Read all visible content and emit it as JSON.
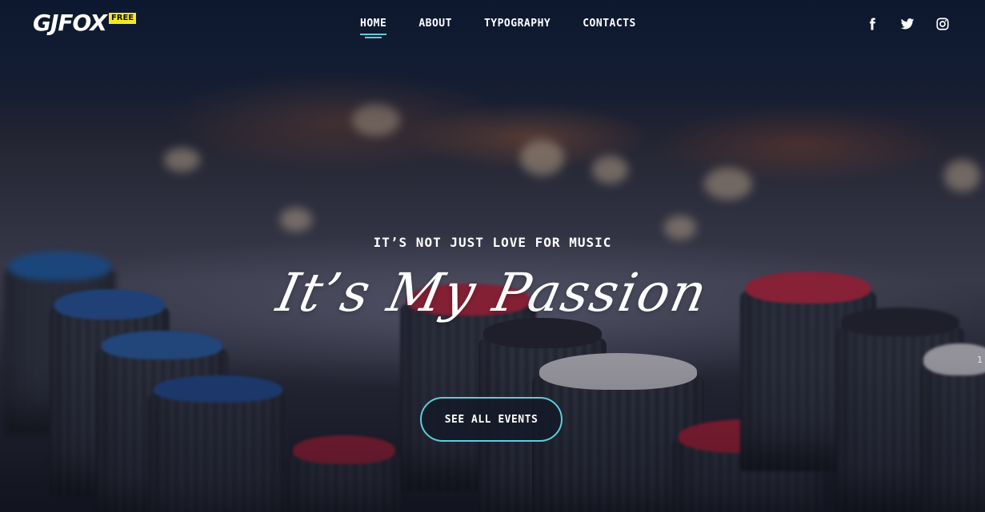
{
  "brand": {
    "logo_prefix": "GJ",
    "logo_name": "FOX",
    "badge": "FREE",
    "accent_color": "#5fcdd9",
    "badge_color": "#f5e629"
  },
  "nav": {
    "items": [
      {
        "label": "HOME",
        "active": true
      },
      {
        "label": "ABOUT",
        "active": false
      },
      {
        "label": "TYPOGRAPHY",
        "active": false
      },
      {
        "label": "CONTACTS",
        "active": false
      }
    ]
  },
  "social": {
    "icons": [
      "facebook-icon",
      "twitter-icon",
      "instagram-icon"
    ]
  },
  "hero": {
    "eyebrow": "IT’S NOT JUST LOVE FOR MUSIC",
    "headline": "It’s My Passion",
    "cta_label": "SEE ALL EVENTS",
    "slide_indicator": "1"
  }
}
